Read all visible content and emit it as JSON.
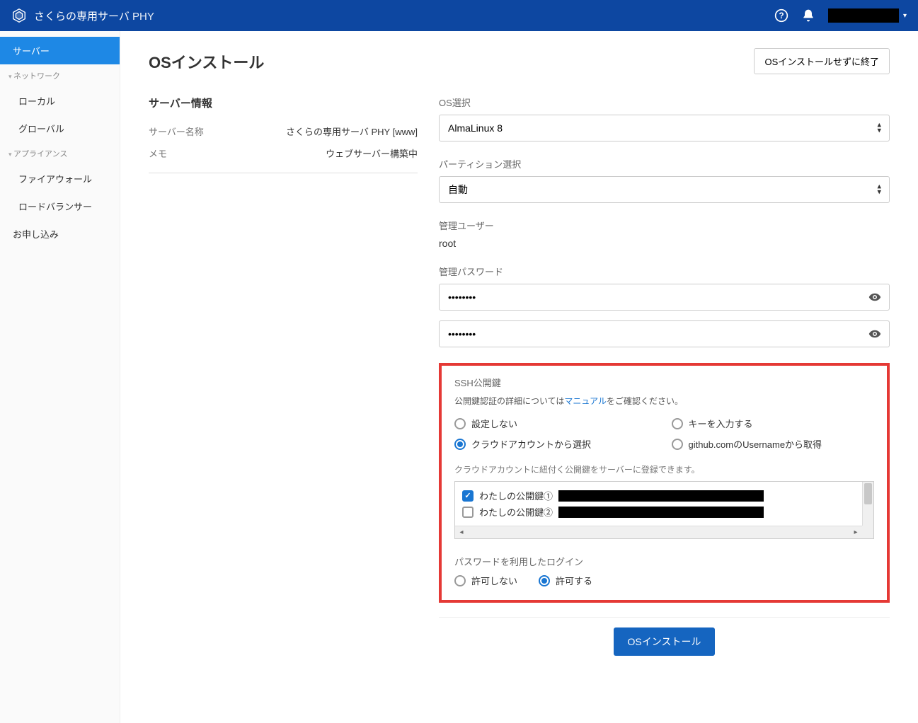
{
  "header": {
    "brand_main": "さくらの専用サーバ",
    "brand_sub": " PHY"
  },
  "sidebar": {
    "server": "サーバー",
    "network_heading": "ネットワーク",
    "local": "ローカル",
    "global": "グローバル",
    "appliance_heading": "アプライアンス",
    "firewall": "ファイアウォール",
    "loadbalancer": "ロードバランサー",
    "apply": "お申し込み"
  },
  "page": {
    "title": "OSインストール",
    "exit_button": "OSインストールせずに終了",
    "submit_button": "OSインストール"
  },
  "server_info": {
    "heading": "サーバー情報",
    "name_label": "サーバー名称",
    "name_value": "さくらの専用サーバ PHY [www]",
    "memo_label": "メモ",
    "memo_value": "ウェブサーバー構築中"
  },
  "form": {
    "os_label": "OS選択",
    "os_value": "AlmaLinux 8",
    "partition_label": "パーティション選択",
    "partition_value": "自動",
    "admin_user_label": "管理ユーザー",
    "admin_user_value": "root",
    "admin_pass_label": "管理パスワード",
    "pass1": "••••••••",
    "pass2": "••••••••"
  },
  "ssh": {
    "heading": "SSH公開鍵",
    "help_pre": "公開鍵認証の詳細については",
    "help_link": "マニュアル",
    "help_post": "をご確認ください。",
    "opt_none": "設定しない",
    "opt_input": "キーを入力する",
    "opt_cloud": "クラウドアカウントから選択",
    "opt_github": "github.comのUsernameから取得",
    "selected": "cloud",
    "cloud_note": "クラウドアカウントに紐付く公開鍵をサーバーに登録できます。",
    "keys": [
      {
        "label": "わたしの公開鍵①",
        "checked": true
      },
      {
        "label": "わたしの公開鍵②",
        "checked": false
      }
    ]
  },
  "login": {
    "heading": "パスワードを利用したログイン",
    "deny": "許可しない",
    "allow": "許可する",
    "selected": "allow"
  }
}
